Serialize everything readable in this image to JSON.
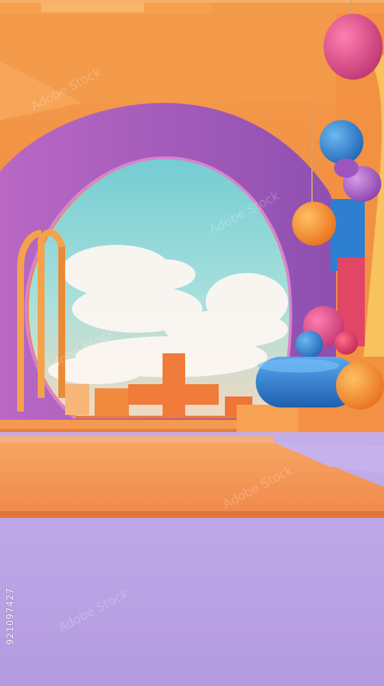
{
  "image": {
    "stock_id": "921097427",
    "watermark": "Adobe Stock"
  },
  "palette": {
    "ceiling_orange": "#f08a3c",
    "arch_purple": "#a45fb9",
    "sky_top": "#7fd2d6",
    "floor_orange": "#f59a52",
    "floor_lavender": "#c8b4ea",
    "ball_blue": "#2f7fd0",
    "ball_magenta": "#e04f8c"
  }
}
